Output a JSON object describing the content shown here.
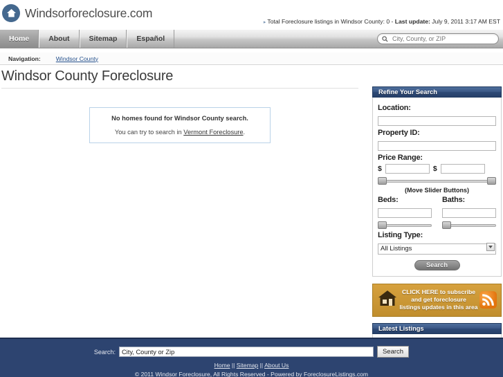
{
  "site": {
    "logo_text": "Windsorforeclosure.com",
    "logo_icon": "house-in-circle-icon"
  },
  "header": {
    "status_bullet": "›",
    "status_text": "Total Foreclosure listings in Windsor County: 0 - ",
    "status_label": "Last update:",
    "status_value": " July 9, 2011 3:17 AM EST",
    "search": {
      "placeholder": "City, County, or ZIP",
      "value": "",
      "icon": "search-icon"
    }
  },
  "nav": {
    "items": [
      {
        "label": "Home",
        "active": true
      },
      {
        "label": "About",
        "active": false
      },
      {
        "label": "Sitemap",
        "active": false
      },
      {
        "label": "Español",
        "active": false
      }
    ]
  },
  "breadcrumb": {
    "label": "Navigation:",
    "link": "Windsor County"
  },
  "main": {
    "page_title": "Windsor County Foreclosure",
    "no_results": {
      "title": "No homes found for Windsor County search.",
      "sub_prefix": "You can try to search in ",
      "sub_link": "Vermont Foreclosure",
      "sub_suffix": "."
    }
  },
  "sidebar": {
    "refine": {
      "title": "Refine Your Search",
      "location_label": "Location:",
      "location_value": "",
      "property_id_label": "Property ID:",
      "property_id_value": "",
      "price_range_label": "Price Range:",
      "price_min_prefix": "$",
      "price_min_value": "",
      "price_max_prefix": "$",
      "price_max_value": "",
      "slider_hint": "(Move Slider Buttons)",
      "beds_label": "Beds:",
      "beds_value": "",
      "baths_label": "Baths:",
      "baths_value": "",
      "listing_type_label": "Listing Type:",
      "listing_type_selected": "All Listings",
      "listing_type_options": [
        "All Listings"
      ],
      "search_button": "Search"
    },
    "ad": {
      "line1": "CLICK HERE to subscribe",
      "line2": "and get foreclosure",
      "line3": "listings updates in this area",
      "house_icon": "house-icon",
      "rss_icon": "rss-icon"
    },
    "latest": {
      "title": "Latest Listings"
    }
  },
  "footer": {
    "search_label": "Search:",
    "search_value": "City, County or Zip",
    "search_placeholder": "City, County or Zip",
    "search_button": "Search",
    "links": [
      {
        "label": "Home"
      },
      {
        "label": "Sitemap"
      },
      {
        "label": "About Us"
      }
    ],
    "link_sep": " || ",
    "copy_prefix": "© 2011 ",
    "copy_link": "Windsor Foreclosure",
    "copy_suffix": ", All Rights Reserved - Powered by ForeclosureListings.com"
  },
  "colors": {
    "brand_blue": "#2d4470",
    "panel_header_blue": "#3a5785",
    "ad_gold": "#c08e2e",
    "link_blue": "#24508c"
  }
}
